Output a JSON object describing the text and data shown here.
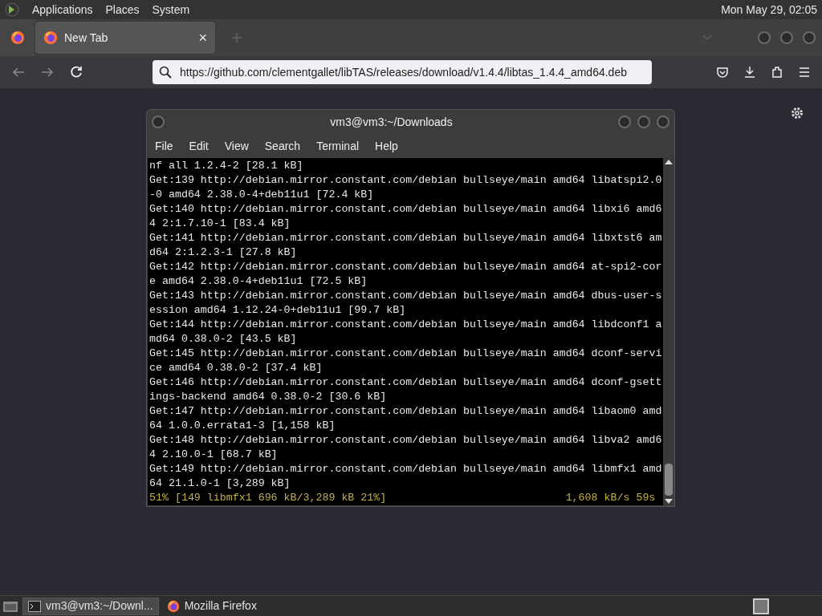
{
  "top_panel": {
    "menus": [
      "Applications",
      "Places",
      "System"
    ],
    "clock": "Mon May 29, 02:05"
  },
  "browser": {
    "tabs": [
      {
        "label": "New Tab",
        "selected": true
      }
    ],
    "tab_close": "×",
    "url": "https://github.com/clementgallet/libTAS/releases/download/v1.4.4/libtas_1.4.4_amd64.deb"
  },
  "terminal": {
    "title": "vm3@vm3:~/Downloads",
    "menus": [
      "File",
      "Edit",
      "View",
      "Search",
      "Terminal",
      "Help"
    ],
    "lines": [
      {
        "text": "nf all 1.2.4-2 [28.1 kB]",
        "kind": "output"
      },
      {
        "text": "Get:139 http://debian.mirror.constant.com/debian bullseye/main amd64 libatspi2.0",
        "kind": "output"
      },
      {
        "text": "-0 amd64 2.38.0-4+deb11u1 [72.4 kB]",
        "kind": "output"
      },
      {
        "text": "Get:140 http://debian.mirror.constant.com/debian bullseye/main amd64 libxi6 amd6",
        "kind": "output"
      },
      {
        "text": "4 2:1.7.10-1 [83.4 kB]",
        "kind": "output"
      },
      {
        "text": "Get:141 http://debian.mirror.constant.com/debian bullseye/main amd64 libxtst6 am",
        "kind": "output"
      },
      {
        "text": "d64 2:1.2.3-1 [27.8 kB]",
        "kind": "output"
      },
      {
        "text": "Get:142 http://debian.mirror.constant.com/debian bullseye/main amd64 at-spi2-cor",
        "kind": "output"
      },
      {
        "text": "e amd64 2.38.0-4+deb11u1 [72.5 kB]",
        "kind": "output"
      },
      {
        "text": "Get:143 http://debian.mirror.constant.com/debian bullseye/main amd64 dbus-user-s",
        "kind": "output"
      },
      {
        "text": "ession amd64 1.12.24-0+deb11u1 [99.7 kB]",
        "kind": "output"
      },
      {
        "text": "Get:144 http://debian.mirror.constant.com/debian bullseye/main amd64 libdconf1 a",
        "kind": "output"
      },
      {
        "text": "md64 0.38.0-2 [43.5 kB]",
        "kind": "output"
      },
      {
        "text": "Get:145 http://debian.mirror.constant.com/debian bullseye/main amd64 dconf-servi",
        "kind": "output"
      },
      {
        "text": "ce amd64 0.38.0-2 [37.4 kB]",
        "kind": "output"
      },
      {
        "text": "Get:146 http://debian.mirror.constant.com/debian bullseye/main amd64 dconf-gsett",
        "kind": "output"
      },
      {
        "text": "ings-backend amd64 0.38.0-2 [30.6 kB]",
        "kind": "output"
      },
      {
        "text": "Get:147 http://debian.mirror.constant.com/debian bullseye/main amd64 libaom0 amd",
        "kind": "output"
      },
      {
        "text": "64 1.0.0.errata1-3 [1,158 kB]",
        "kind": "output"
      },
      {
        "text": "Get:148 http://debian.mirror.constant.com/debian bullseye/main amd64 libva2 amd6",
        "kind": "output"
      },
      {
        "text": "4 2.10.0-1 [68.7 kB]",
        "kind": "output"
      },
      {
        "text": "Get:149 http://debian.mirror.constant.com/debian bullseye/main amd64 libmfx1 amd",
        "kind": "output"
      },
      {
        "text": "64 21.1.0-1 [3,289 kB]",
        "kind": "output"
      }
    ],
    "progress": {
      "left": "51% [149 libmfx1 696 kB/3,289 kB 21%]",
      "right": "1,608 kB/s 59s"
    }
  },
  "taskbar": {
    "items": [
      {
        "label": "vm3@vm3:~/Downl...",
        "kind": "terminal",
        "selected": true
      },
      {
        "label": "Mozilla Firefox",
        "kind": "firefox",
        "selected": false
      }
    ]
  }
}
